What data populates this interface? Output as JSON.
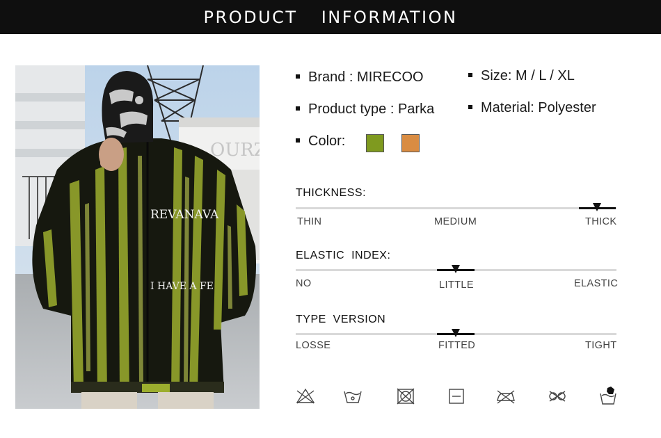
{
  "header": {
    "title_left": "PRODUCT",
    "title_right": "INFORMATION"
  },
  "photo": {
    "jacket_print_top": "REVANAVA",
    "jacket_print_bottom": "I HAVE A FE",
    "building_sign": "OURZ"
  },
  "specs": {
    "brand": "Brand : MIRECOO",
    "size": "Size: M / L / XL",
    "product_type": "Product type : Parka",
    "material": "Material: Polyester",
    "color_label": "Color:",
    "colors": [
      "#7f9a1f",
      "#d98c42"
    ]
  },
  "scales": [
    {
      "title": "THICKNESS:",
      "labels": [
        "THIN",
        "MEDIUM",
        "THICK"
      ],
      "selected": "THICK"
    },
    {
      "title": "ELASTIC  INDEX:",
      "labels": [
        "NO",
        "LITTLE",
        "ELASTIC"
      ],
      "selected": "LITTLE"
    },
    {
      "title": "TYPE  VERSION",
      "labels": [
        "LOSSE",
        "FITTED",
        "TIGHT"
      ],
      "selected": "FITTED"
    }
  ],
  "care_icons": [
    "do-not-bleach-icon",
    "hand-wash-icon",
    "do-not-tumble-dry-icon",
    "flat-dry-icon",
    "do-not-iron-icon",
    "do-not-dry-clean-icon",
    "hand-wash-glove-icon"
  ],
  "colors": {
    "header_bg": "#0f0f0f",
    "accent": "#111111",
    "track": "#d9d9d9"
  }
}
